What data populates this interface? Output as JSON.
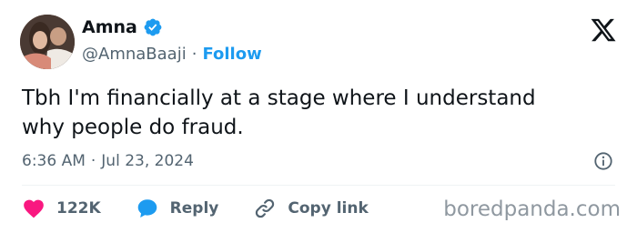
{
  "author": {
    "name": "Amna",
    "handle": "@AmnaBaaji",
    "separator": "·",
    "follow_label": "Follow",
    "verified_color": "#1d9bf0"
  },
  "tweet": {
    "text": "Tbh I'm financially at a stage where I understand\nwhy people do fraud.",
    "time": "6:36 AM",
    "meta_separator": "·",
    "date": "Jul 23, 2024"
  },
  "actions": {
    "likes_count": "122K",
    "reply_label": "Reply",
    "copy_link_label": "Copy link"
  },
  "colors": {
    "accent": "#1d9bf0",
    "like": "#f91880",
    "text": "#0f1419",
    "muted": "#536471"
  },
  "icons": {
    "platform_logo": "x-logo-icon",
    "verified": "verified-badge-icon",
    "info": "info-icon",
    "like": "heart-icon",
    "reply": "reply-bubble-icon",
    "copy_link": "link-icon"
  },
  "watermark": "boredpanda.com"
}
